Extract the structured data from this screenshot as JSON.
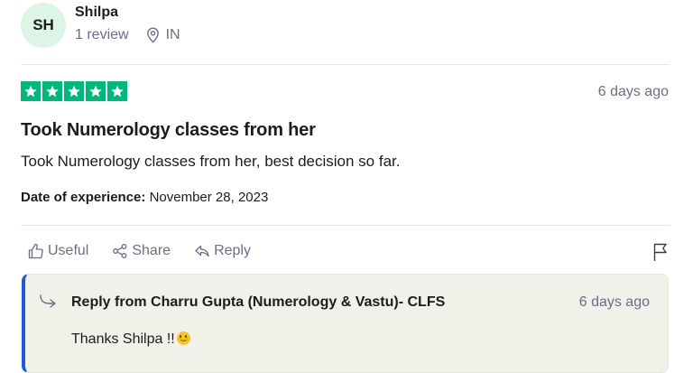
{
  "reviewer": {
    "initials": "SH",
    "name": "Shilpa",
    "review_count": "1 review",
    "country": "IN"
  },
  "review": {
    "rating": 5,
    "date_ago": "6 days ago",
    "title": "Took Numerology classes from her",
    "body": "Took Numerology classes from her, best decision so far.",
    "experience_label": "Date of experience:",
    "experience_date": "November 28, 2023"
  },
  "actions": {
    "useful": "Useful",
    "share": "Share",
    "reply": "Reply"
  },
  "reply": {
    "header": "Reply from Charru Gupta (Numerology & Vastu)- CLFS",
    "date_ago": "6 days ago",
    "text": "Thanks Shilpa !!",
    "emoji": "slightly-smiling-face"
  },
  "colors": {
    "star_green": "#00b67a",
    "avatar_bg": "#dcf5e7",
    "reply_accent": "#1f5bd7",
    "reply_bg": "#f1f1ea",
    "muted_text": "#6c6c85"
  }
}
